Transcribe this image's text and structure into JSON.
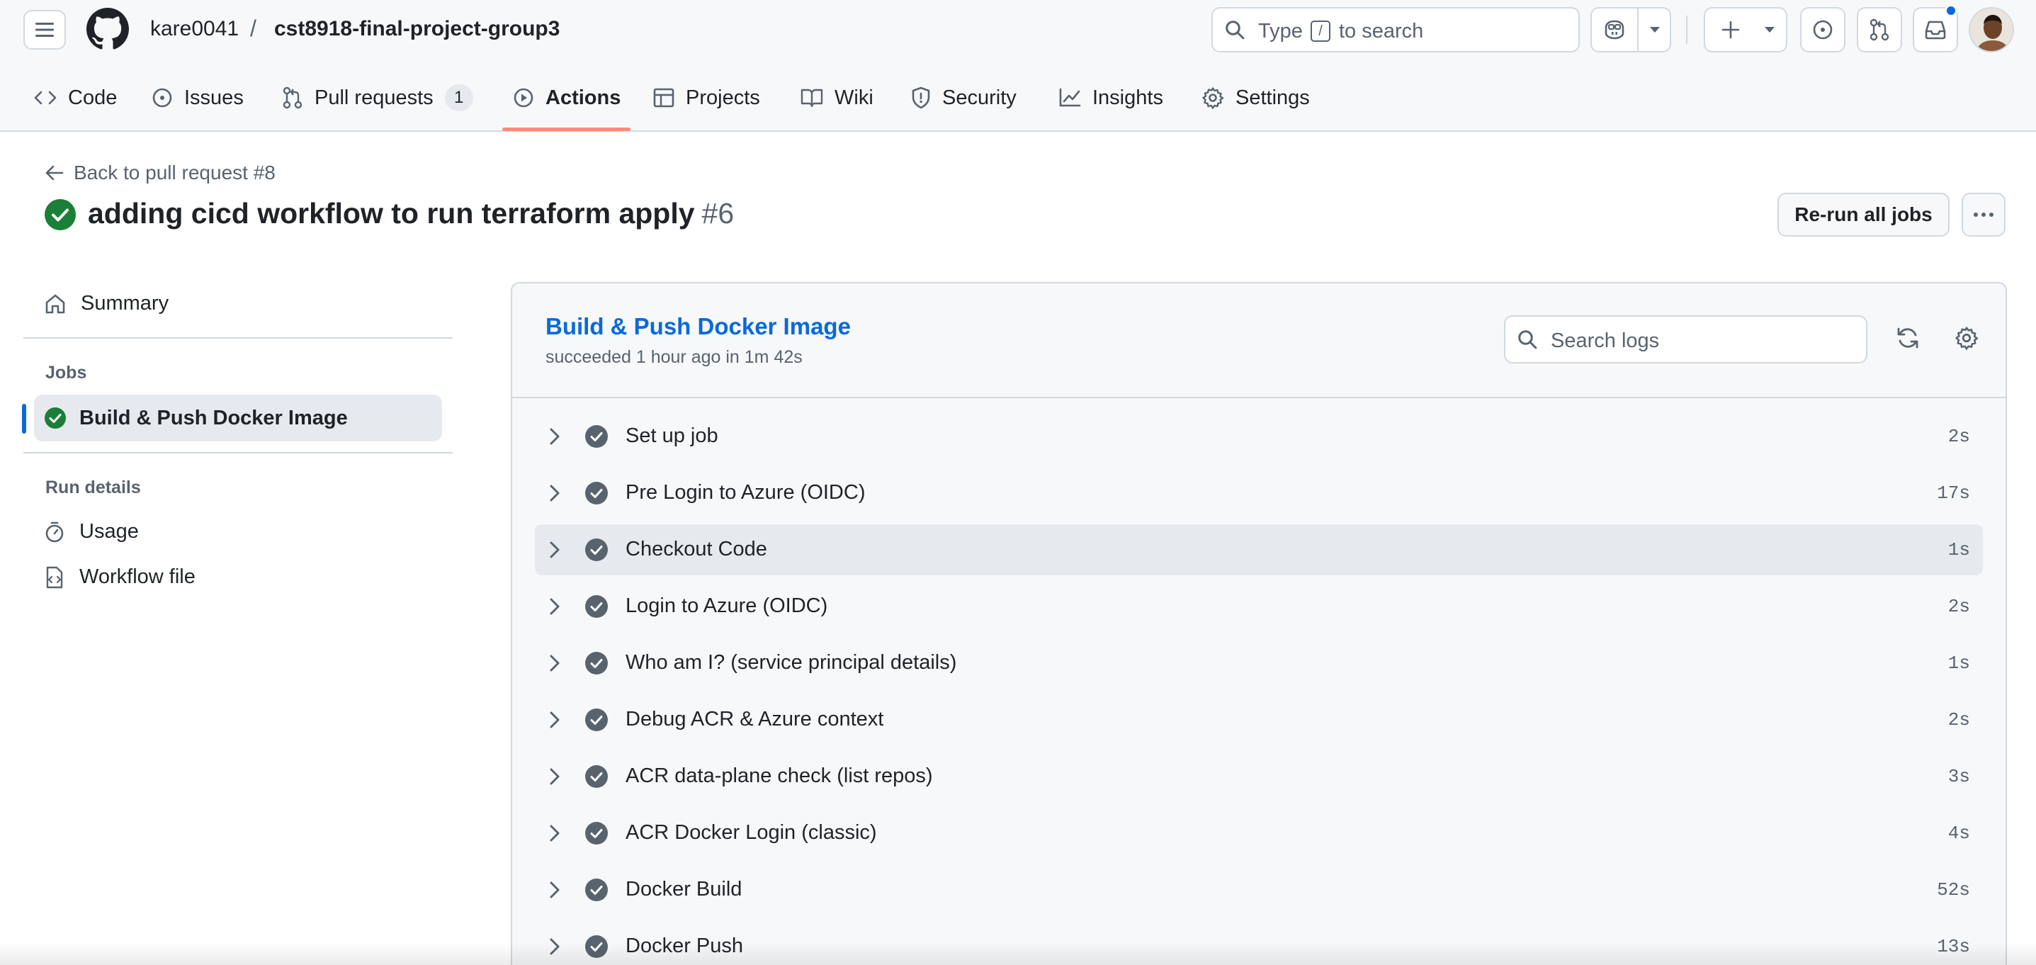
{
  "header": {
    "owner": "kare0041",
    "separator": "/",
    "repo": "cst8918-final-project-group3",
    "search": {
      "prefix": "Type",
      "key": "/",
      "suffix": "to search"
    },
    "icons": [
      "hamburger-icon",
      "github-logo",
      "copilot-icon",
      "plus-icon",
      "issue-icon",
      "pull-request-icon",
      "inbox-icon"
    ]
  },
  "tabs": [
    {
      "label": "Code",
      "icon": "code-icon"
    },
    {
      "label": "Issues",
      "icon": "issue-icon"
    },
    {
      "label": "Pull requests",
      "icon": "pull-request-icon",
      "count": "1"
    },
    {
      "label": "Actions",
      "icon": "play-icon",
      "active": true
    },
    {
      "label": "Projects",
      "icon": "table-icon"
    },
    {
      "label": "Wiki",
      "icon": "book-icon"
    },
    {
      "label": "Security",
      "icon": "shield-icon"
    },
    {
      "label": "Insights",
      "icon": "graph-icon"
    },
    {
      "label": "Settings",
      "icon": "gear-icon"
    }
  ],
  "run": {
    "back_label": "Back to pull request #8",
    "title": "adding cicd workflow to run terraform apply",
    "number": "#6",
    "rerun_label": "Re-run all jobs"
  },
  "sidebar": {
    "summary_label": "Summary",
    "jobs_heading": "Jobs",
    "active_job": "Build & Push Docker Image",
    "details_heading": "Run details",
    "usage_label": "Usage",
    "workflow_label": "Workflow file"
  },
  "log": {
    "job_title": "Build & Push Docker Image",
    "job_status": "succeeded 1 hour ago in 1m 42s",
    "search_placeholder": "Search logs",
    "steps": [
      {
        "name": "Set up job",
        "duration": "2s"
      },
      {
        "name": "Pre Login to Azure (OIDC)",
        "duration": "17s"
      },
      {
        "name": "Checkout Code",
        "duration": "1s",
        "highlighted": true
      },
      {
        "name": "Login to Azure (OIDC)",
        "duration": "2s"
      },
      {
        "name": "Who am I? (service principal details)",
        "duration": "1s"
      },
      {
        "name": "Debug ACR & Azure context",
        "duration": "2s"
      },
      {
        "name": "ACR data-plane check (list repos)",
        "duration": "3s"
      },
      {
        "name": "ACR Docker Login (classic)",
        "duration": "4s"
      },
      {
        "name": "Docker Build",
        "duration": "52s"
      },
      {
        "name": "Docker Push",
        "duration": "13s"
      }
    ]
  },
  "colors": {
    "accent_blue": "#0969da",
    "success_green": "#1a7f37",
    "tab_underline": "#fd8c73",
    "step_check": "#59636e"
  }
}
